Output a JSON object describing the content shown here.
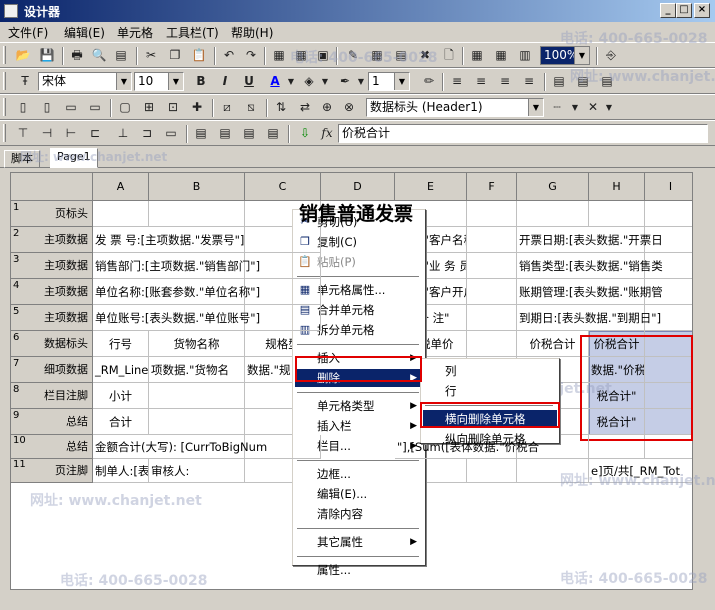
{
  "window": {
    "title": "设计器",
    "min": "_",
    "max": "□",
    "close": "×"
  },
  "menu": [
    "文件(F)",
    "编辑(E)",
    "单元格",
    "工具栏(T)",
    "帮助(H)"
  ],
  "format_toolbar": {
    "font": "宋体",
    "size": "10",
    "line_width": "1"
  },
  "style_toolbar": {
    "zoom": "100%"
  },
  "field_combo": "数据标头 (Header1)",
  "formula": {
    "fx_label": "fx",
    "text": "价税合计"
  },
  "tabs": [
    "脚本",
    "Page1"
  ],
  "columns": [
    "A",
    "B",
    "C",
    "D",
    "E",
    "F",
    "G",
    "H",
    "I"
  ],
  "rows": [
    {
      "num": "1",
      "label": "页标头",
      "cells": [
        "",
        "",
        "",
        "销售普通发票",
        "",
        "",
        "",
        "",
        ""
      ]
    },
    {
      "num": "2",
      "label": "主项数据",
      "cells": [
        "发 票 号:[主项数据.\"发票号\"]",
        "",
        "",
        "",
        "数据.\"客户名称",
        "",
        "开票日期:[表头数据.\"开票日",
        "",
        ""
      ]
    },
    {
      "num": "3",
      "label": "主项数据",
      "cells": [
        "销售部门:[主项数据.\"销售部门\"]",
        "",
        "",
        "",
        "数据.\"业 务 员",
        "",
        "销售类型:[表头数据.\"销售类",
        "",
        ""
      ]
    },
    {
      "num": "4",
      "label": "主项数据",
      "cells": [
        "单位名称:[账套参数.\"单位名称\"]",
        "",
        "",
        "",
        "数据.\"客户开户",
        "",
        "账期管理:[表头数据.\"账期管",
        "",
        ""
      ]
    },
    {
      "num": "5",
      "label": "主项数据",
      "cells": [
        "单位账号:[表头数据.\"单位账号\"]",
        "",
        "",
        "",
        "据.\"备    注\"",
        "",
        "到期日:[表头数据.\"到期日\"]",
        "",
        ""
      ]
    },
    {
      "num": "6",
      "label": "数据标头",
      "cells": [
        "行号",
        "货物名称",
        "规格型",
        "",
        "含税单价",
        "",
        "价税合计",
        "价税合计",
        ""
      ]
    },
    {
      "num": "7",
      "label": "细项数据",
      "cells": [
        "_RM_Line",
        "项数据.\"货物名",
        "数据.\"规",
        "",
        "",
        "",
        "税",
        "数据.\"价税",
        ""
      ]
    },
    {
      "num": "8",
      "label": "栏目注脚",
      "cells": [
        "小计",
        "",
        "",
        "",
        "",
        "",
        "\"]",
        "税合计\"",
        ""
      ]
    },
    {
      "num": "9",
      "label": "总结",
      "cells": [
        "合计",
        "",
        "",
        "",
        "",
        "",
        "\"]",
        "税合计\"",
        ""
      ]
    },
    {
      "num": "10",
      "label": "总结",
      "cells": [
        "金额合计(大写): [CurrToBigNum",
        "",
        "",
        "",
        "\"],[Sum([表体数据.\"价税合",
        "",
        "",
        "",
        ""
      ]
    },
    {
      "num": "11",
      "label": "页注脚",
      "cells": [
        "制单人:[表头数据.\"制单",
        "审核人:",
        "",
        "",
        "",
        "",
        "",
        "e]页/共[_RM_Tot",
        ""
      ]
    }
  ],
  "context_menu": [
    {
      "label": "剪切(U)",
      "icon": "cut-icon"
    },
    {
      "label": "复制(C)",
      "icon": "copy-icon"
    },
    {
      "label": "粘贴(P)",
      "icon": "paste-icon",
      "disabled": true
    },
    {
      "sep": true
    },
    {
      "label": "单元格属性...",
      "icon": "cell-properties-icon"
    },
    {
      "label": "合并单元格",
      "icon": "merge-cells-icon"
    },
    {
      "label": "拆分单元格",
      "icon": "split-cells-icon"
    },
    {
      "sep": true
    },
    {
      "label": "插入",
      "submenu": true
    },
    {
      "label": "删除",
      "submenu": true,
      "highlight": true
    },
    {
      "sep": true
    },
    {
      "label": "单元格类型",
      "submenu": true
    },
    {
      "label": "插入栏",
      "submenu": true
    },
    {
      "label": "栏目...",
      "submenu": true
    },
    {
      "sep": true
    },
    {
      "label": "边框..."
    },
    {
      "label": "编辑(E)..."
    },
    {
      "label": "清除内容"
    },
    {
      "sep": true
    },
    {
      "label": "其它属性",
      "submenu": true
    },
    {
      "sep": true
    },
    {
      "label": "属性..."
    }
  ],
  "delete_submenu": [
    {
      "label": "列"
    },
    {
      "label": "行"
    },
    {
      "sep": true
    },
    {
      "label": "横向删除单元格",
      "highlight": true
    },
    {
      "label": "纵向删除单元格"
    }
  ],
  "watermarks": [
    "电话: 400-665-0028",
    "网址: www.chanjet.net"
  ],
  "colors": {
    "selection": "#0a246a",
    "highlight_box": "#e00000",
    "selected_cells": "#c5cde6"
  }
}
